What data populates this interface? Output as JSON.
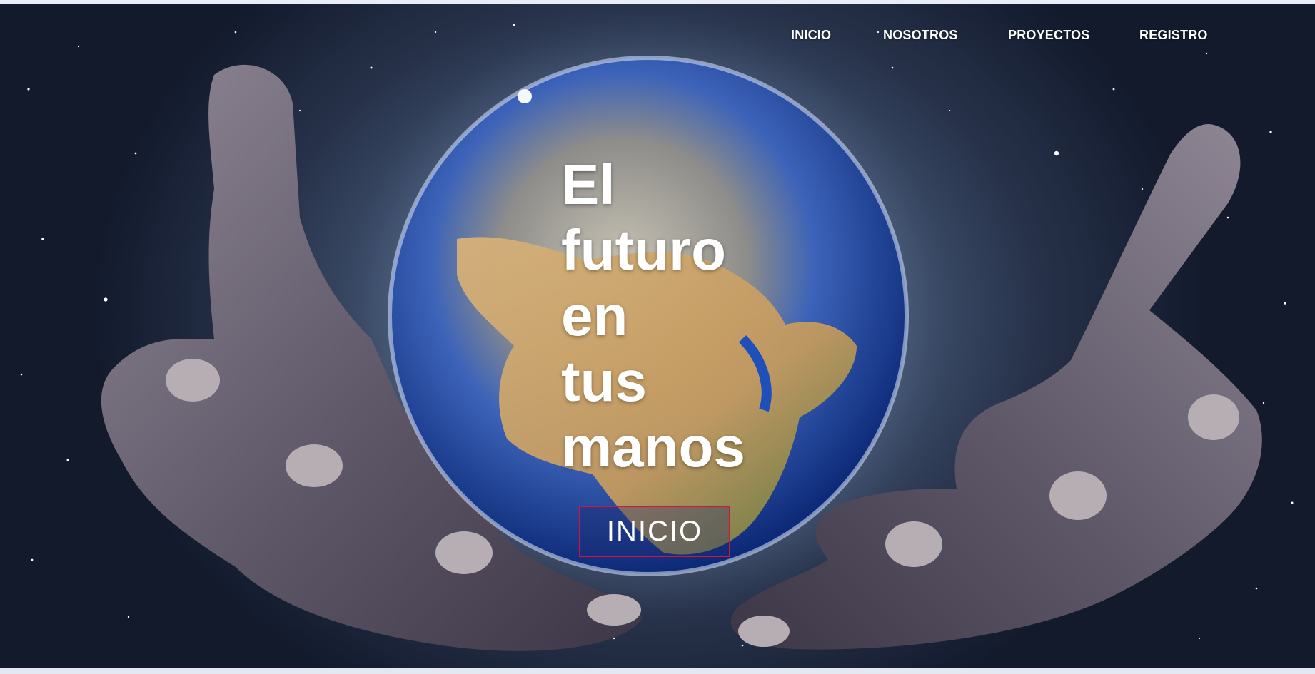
{
  "nav": {
    "items": [
      {
        "label": "INICIO"
      },
      {
        "label": "NOSOTROS"
      },
      {
        "label": "PROYECTOS"
      },
      {
        "label": "REGISTRO"
      }
    ]
  },
  "hero": {
    "headline_lines": [
      "El",
      "futuro",
      "en",
      "tus",
      "manos"
    ],
    "cta_label": "INICIO",
    "image_description_icons": [
      "earth-globe-illustration",
      "left-hand-illustration",
      "right-hand-illustration",
      "starfield-background"
    ]
  },
  "colors": {
    "text": "#ffffff",
    "cta_border": "#d4143c",
    "background_dark": "#121a2c",
    "ocean": "#1f4fb8",
    "land": "#c9a36a"
  }
}
